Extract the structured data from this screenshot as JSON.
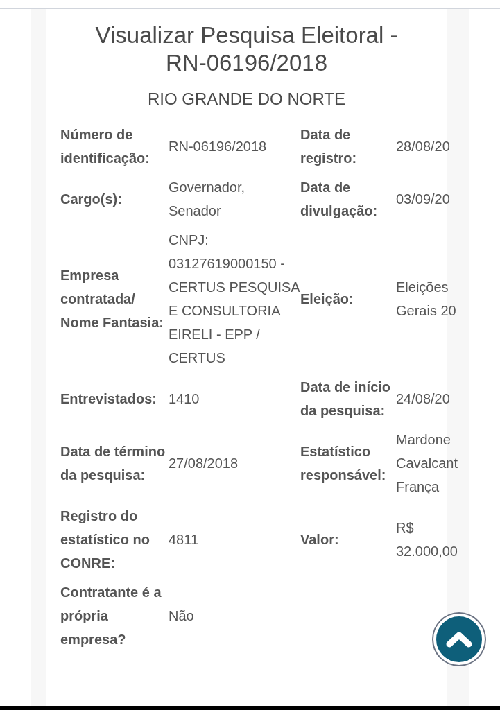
{
  "title": "Visualizar Pesquisa Eleitoral - RN-06196/2018",
  "state": "RIO GRANDE DO NORTE",
  "rows": [
    {
      "label": "Número de identificação:",
      "value": "RN-06196/2018",
      "label_2": "Data de registro:",
      "value_2": "28/08/20"
    },
    {
      "label": "Cargo(s):",
      "value": "Governador, Senador",
      "label_2": "Data de divulgação:",
      "value_2": "03/09/20"
    },
    {
      "label": "Empresa contratada/ Nome Fantasia:",
      "value": "CNPJ: 03127619000150 - CERTUS PESQUISA E CONSULTORIA EIRELI - EPP / CERTUS",
      "label_2": "Eleição:",
      "value_2": "Eleições Gerais 20"
    },
    {
      "label": "Entrevistados:",
      "value": "1410",
      "label_2": "Data de início da pesquisa:",
      "value_2": "24/08/20"
    },
    {
      "label": "Data de término da pesquisa:",
      "value": "27/08/2018",
      "label_2": "Estatístico responsável:",
      "value_2": "Mardone Cavalcant França"
    },
    {
      "label": "Registro do estatístico no CONRE:",
      "value": "4811",
      "label_2": "Valor:",
      "value_2": "R$ 32.000,00"
    },
    {
      "label": "Contratante é a própria empresa?",
      "value": "Não"
    }
  ]
}
